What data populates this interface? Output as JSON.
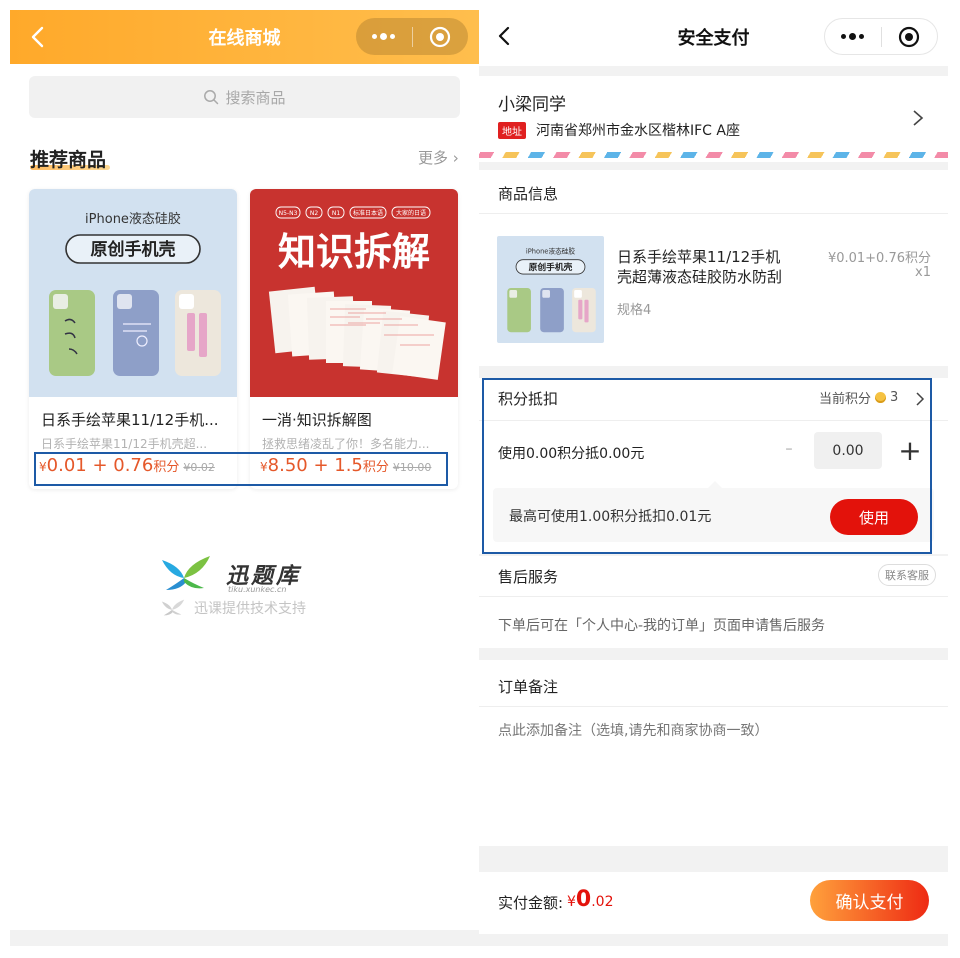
{
  "left": {
    "header": {
      "title": "在线商城"
    },
    "search": {
      "placeholder": "搜索商品"
    },
    "section": {
      "title": "推荐商品",
      "more": "更多"
    },
    "products": [
      {
        "image_title_small": "iPhone液态硅胶",
        "image_title_big": "原创手机壳",
        "name": "日系手绘苹果11/12手机...",
        "subtitle": "日系手绘苹果11/12手机壳超...",
        "currency": "¥",
        "price": "0.01 + 0.76",
        "unit": "积分",
        "original": "¥0.02"
      },
      {
        "image_tags": [
          "N5-N3",
          "N2",
          "N1",
          "标准日本语",
          "大家的日语"
        ],
        "image_title_big": "知识拆解",
        "name": "一消·知识拆解图",
        "subtitle": "拯救思绪凌乱了你！多名能力...",
        "currency": "¥",
        "price": "8.50 + 1.5",
        "unit": "积分",
        "original": "¥10.00"
      }
    ],
    "logo": {
      "text": "迅题库",
      "url_text": "tiku.xunkec.cn"
    },
    "support": "迅课提供技术支持"
  },
  "right": {
    "header": {
      "title": "安全支付"
    },
    "address": {
      "name": "小梁同学",
      "tag": "地址",
      "text": "河南省郑州市金水区楷林IFC A座"
    },
    "goods": {
      "section_title": "商品信息",
      "image_title_small": "iPhone液态硅胶",
      "image_title_big": "原创手机壳",
      "name": "日系手绘苹果11/12手机壳超薄液态硅胶防水防刮全...",
      "price": "¥0.01+0.76积分",
      "qty": "x1",
      "spec": "规格4"
    },
    "points": {
      "title": "积分抵扣",
      "current_label": "当前积分",
      "current_value": "3",
      "use_text": "使用0.00积分抵0.00元",
      "minus": "-",
      "input_value": "0.00",
      "plus": "+",
      "tip": "最高可使用1.00积分抵扣0.01元",
      "use_button": "使用"
    },
    "service": {
      "title": "售后服务",
      "contact_button": "联系客服",
      "text": "下单后可在「个人中心-我的订单」页面申请售后服务"
    },
    "remark": {
      "title": "订单备注",
      "placeholder": "点此添加备注（选填,请先和商家协商一致）"
    },
    "pay": {
      "label": "实付金额:",
      "currency": "¥",
      "integer": "0",
      "decimal": ".02",
      "button": "确认支付"
    }
  },
  "colors": {
    "orange_header": "#ffa92a",
    "price_orange": "#e5582a",
    "red": "#e3120b",
    "highlight_blue": "#1d5aa6"
  }
}
